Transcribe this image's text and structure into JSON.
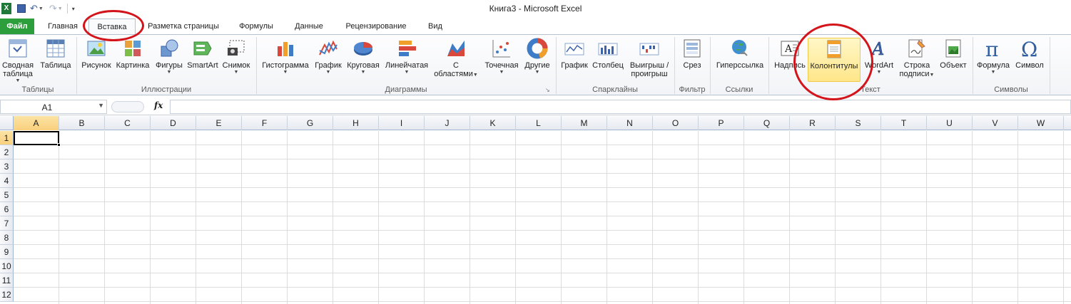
{
  "window": {
    "title": "Книга3  -  Microsoft Excel"
  },
  "quick_access": {
    "icons": [
      "excel-logo-icon",
      "save-icon",
      "undo-icon",
      "redo-icon",
      "customize-icon"
    ]
  },
  "tabs": [
    {
      "label": "Файл",
      "id": "file"
    },
    {
      "label": "Главная",
      "id": "home"
    },
    {
      "label": "Вставка",
      "id": "insert",
      "active": true
    },
    {
      "label": "Разметка страницы",
      "id": "page-layout"
    },
    {
      "label": "Формулы",
      "id": "formulas"
    },
    {
      "label": "Данные",
      "id": "data"
    },
    {
      "label": "Рецензирование",
      "id": "review"
    },
    {
      "label": "Вид",
      "id": "view"
    }
  ],
  "ribbon": {
    "groups": {
      "tables": "Таблицы",
      "illustrations": "Иллюстрации",
      "charts": "Диаграммы",
      "sparklines": "Спарклайны",
      "filter": "Фильтр",
      "links": "Ссылки",
      "text": "Текст",
      "symbols": "Символы"
    },
    "buttons": {
      "pivot_1": "Сводная",
      "pivot_2": "таблица",
      "table": "Таблица",
      "picture": "Рисунок",
      "clipart": "Картинка",
      "shapes": "Фигуры",
      "smartart": "SmartArt",
      "screenshot": "Снимок",
      "column": "Гистограмма",
      "line": "График",
      "pie": "Круговая",
      "bar": "Линейчатая",
      "area_1": "С",
      "area_2": "областями",
      "scatter": "Точечная",
      "other": "Другие",
      "spark_line": "График",
      "spark_column": "Столбец",
      "spark_winloss_1": "Выигрыш /",
      "spark_winloss_2": "проигрыш",
      "slicer": "Срез",
      "hyperlink": "Гиперссылка",
      "textbox": "Надпись",
      "header_footer": "Колонтитулы",
      "wordart": "WordArt",
      "signature_1": "Строка",
      "signature_2": "подписи",
      "object": "Объект",
      "equation": "Формула",
      "symbol": "Символ"
    }
  },
  "formula_bar": {
    "name_box": "A1",
    "fx": "fx",
    "formula": ""
  },
  "sheet": {
    "columns": [
      "A",
      "B",
      "C",
      "D",
      "E",
      "F",
      "G",
      "H",
      "I",
      "J",
      "K",
      "L",
      "M",
      "N",
      "O",
      "P",
      "Q",
      "R",
      "S",
      "T",
      "U",
      "V",
      "W"
    ],
    "rows": [
      "1",
      "2",
      "3",
      "4",
      "5",
      "6",
      "7",
      "8",
      "9",
      "10",
      "11",
      "12"
    ],
    "active_cell": "A1"
  },
  "annotations": [
    "insert-tab-circle",
    "header-footer-circle"
  ],
  "colors": {
    "file_tab": "#2c9e3b",
    "annotation": "#d4141b",
    "highlight": "#ffe68a"
  }
}
